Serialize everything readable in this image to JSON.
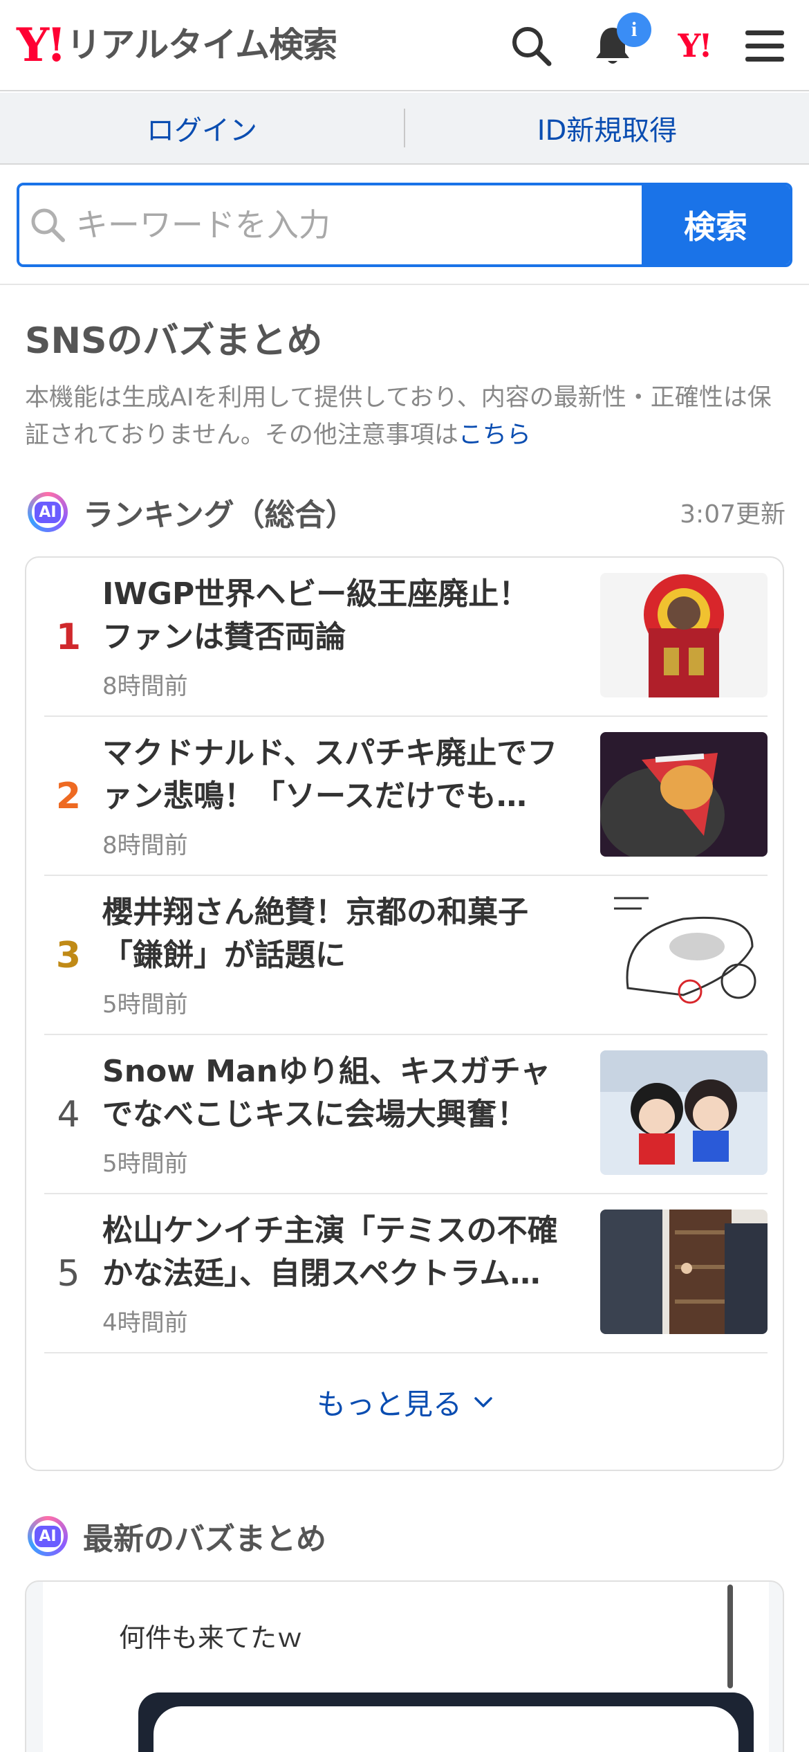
{
  "header": {
    "logo_mark": "Y!",
    "logo_text": "リアルタイム検索",
    "notification_count": "i",
    "yj_mark": "Y!"
  },
  "auth": {
    "login_label": "ログイン",
    "signup_label": "ID新規取得"
  },
  "search": {
    "placeholder": "キーワードを入力",
    "button_label": "検索"
  },
  "buzz": {
    "heading": "SNSのバズまとめ",
    "notice": "本機能は生成AIを利用して提供しており、内容の最新性・正確性は保証されておりません。その他注意事項は",
    "notice_link": "こちら"
  },
  "ranking": {
    "ai_label": "AI",
    "title": "ランキング（総合）",
    "updated": "3:07更新",
    "items": [
      {
        "rank": "1",
        "title": "IWGP世界ヘビー級王座廃止！ファンは賛否両論",
        "time": "8時間前"
      },
      {
        "rank": "2",
        "title": "マクドナルド、スパチキ廃止でファン悲鳴！「ソースだけでも売...",
        "time": "8時間前"
      },
      {
        "rank": "3",
        "title": "櫻井翔さん絶賛！京都の和菓子「鎌餅」が話題に",
        "time": "5時間前"
      },
      {
        "rank": "4",
        "title": "Snow Manゆり組、キスガチャでなべこじキスに会場大興奮！",
        "time": "5時間前"
      },
      {
        "rank": "5",
        "title": "松山ケンイチ主演「テミスの不確かな法廷」、自閉スペクトラム症...",
        "time": "4時間前"
      }
    ],
    "more_label": "もっと見る",
    "rank_colors": [
      "#d0282c",
      "#ee6a22",
      "#c08a16",
      "#555555",
      "#555555"
    ]
  },
  "latest": {
    "ai_label": "AI",
    "title": "最新のバズまとめ",
    "post_text": "何件も来てたｗ"
  },
  "icons": {
    "search": "search-icon",
    "bell": "bell-icon",
    "menu": "hamburger-menu-icon",
    "chevron": "chevron-down-icon"
  }
}
